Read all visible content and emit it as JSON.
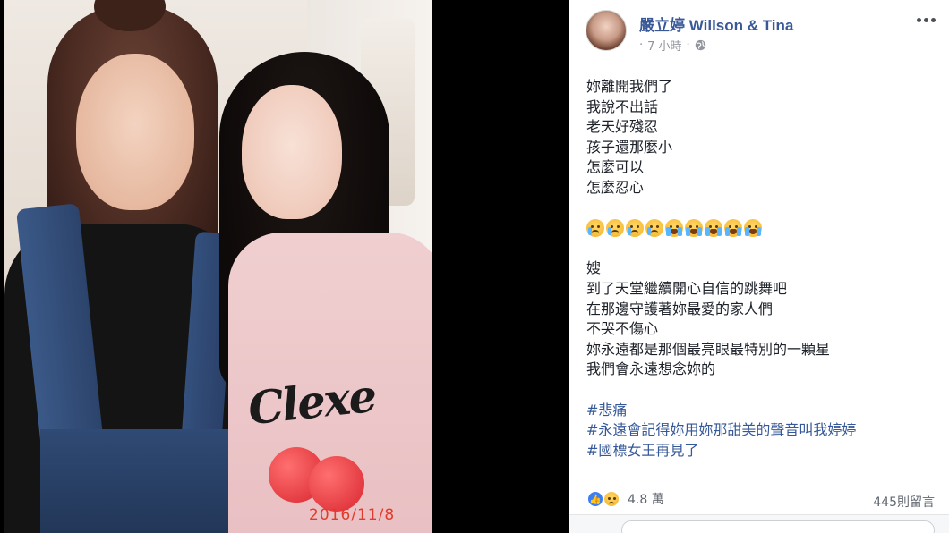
{
  "photo": {
    "shirt_text": "Clexe",
    "date_stamp": "2016/11/8"
  },
  "post": {
    "author": "嚴立婷 Willson & Tina",
    "time": "7 小時",
    "separator": "·",
    "privacy_icon": "globe-icon",
    "more_icon": "more-options-icon",
    "lines_a": [
      "妳離開我們了",
      "我說不出話",
      "老天好殘忍",
      "孩子還那麼小",
      "怎麼可以",
      "怎麼忍心"
    ],
    "emojis": [
      "crying-face",
      "crying-face",
      "crying-face",
      "crying-face",
      "loudly-crying-face",
      "loudly-crying-face",
      "loudly-crying-face",
      "loudly-crying-face",
      "loudly-crying-face"
    ],
    "lines_b": [
      "嫂",
      "到了天堂繼續開心自信的跳舞吧",
      "在那邊守護著妳最愛的家人們",
      "不哭不傷心",
      "妳永遠都是那個最亮眼最特別的一顆星",
      "我們會永遠想念妳的"
    ],
    "hashtags": [
      "#悲痛",
      "#永遠會記得妳用妳那甜美的聲音叫我婷婷",
      "#國標女王再見了"
    ]
  },
  "footer": {
    "reaction_count": "4.8 萬",
    "comment_count": "445則留言"
  },
  "colors": {
    "link_blue": "#385898",
    "meta_gray": "#90949c",
    "date_red": "#e23b2b"
  }
}
